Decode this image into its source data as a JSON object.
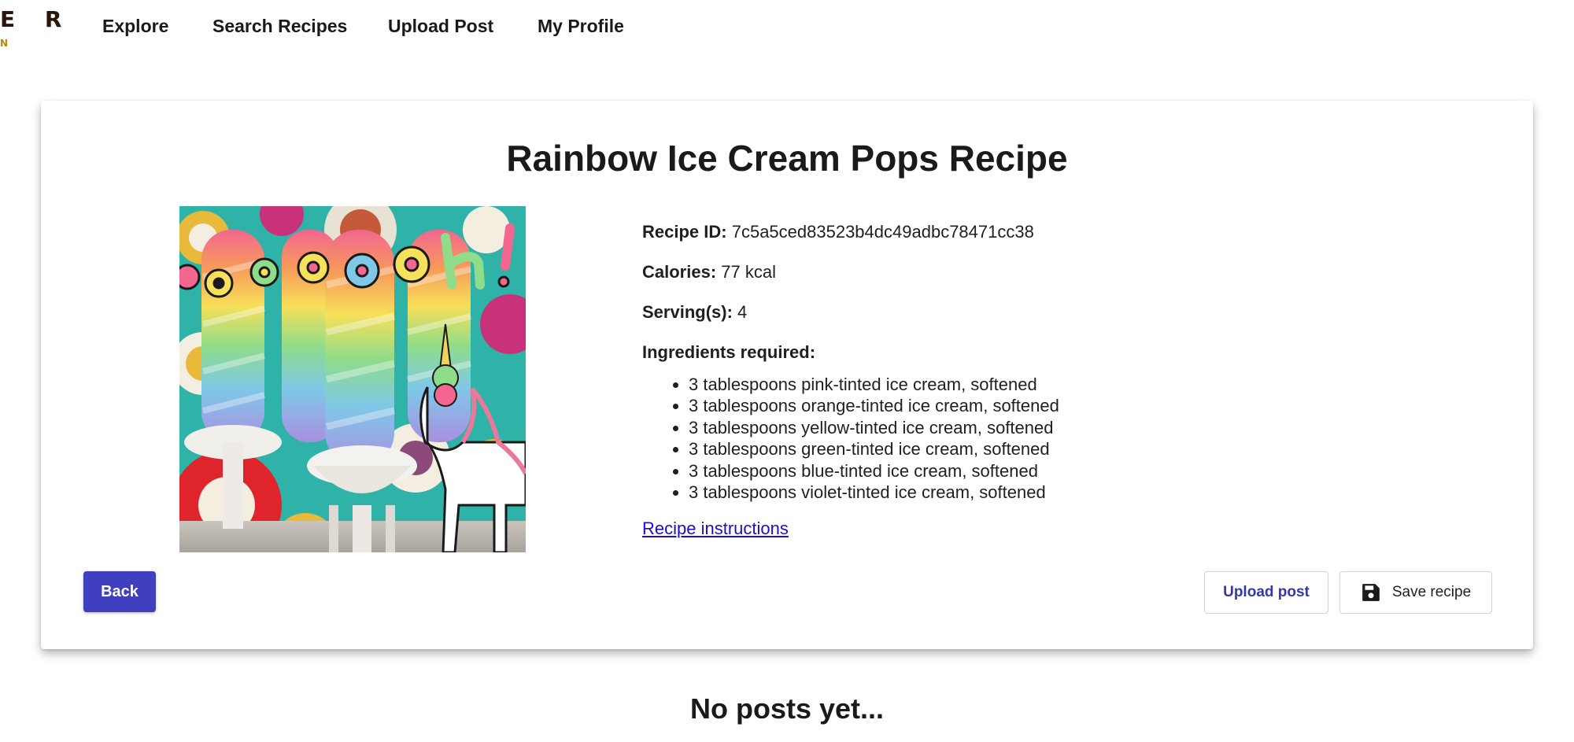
{
  "logo": {
    "main": "E R",
    "sub": "N"
  },
  "nav": {
    "explore": "Explore",
    "search": "Search Recipes",
    "upload": "Upload Post",
    "profile": "My Profile"
  },
  "recipe": {
    "title": "Rainbow Ice Cream Pops Recipe",
    "image_text": "ooooooh!",
    "id_label": "Recipe ID:",
    "id_value": "7c5a5ced83523b4dc49adbc78471cc38",
    "calories_label": "Calories:",
    "calories_value": "77 kcal",
    "servings_label": "Serving(s):",
    "servings_value": "4",
    "ingredients_label": "Ingredients required:",
    "ingredients": [
      "3 tablespoons pink-tinted ice cream, softened",
      "3 tablespoons orange-tinted ice cream, softened",
      "3 tablespoons yellow-tinted ice cream, softened",
      "3 tablespoons green-tinted ice cream, softened",
      "3 tablespoons blue-tinted ice cream, softened",
      "3 tablespoons violet-tinted ice cream, softened"
    ],
    "instructions_link": "Recipe instructions"
  },
  "actions": {
    "back": "Back",
    "upload_post": "Upload post",
    "save_recipe": "Save recipe",
    "save_icon": "floppy-disk-icon"
  },
  "posts": {
    "empty_message": "No posts yet..."
  },
  "colors": {
    "primary": "#3f3fbf",
    "link": "#1a0dd6",
    "logo_dark": "#2a160c",
    "logo_gold": "#b8860b"
  }
}
